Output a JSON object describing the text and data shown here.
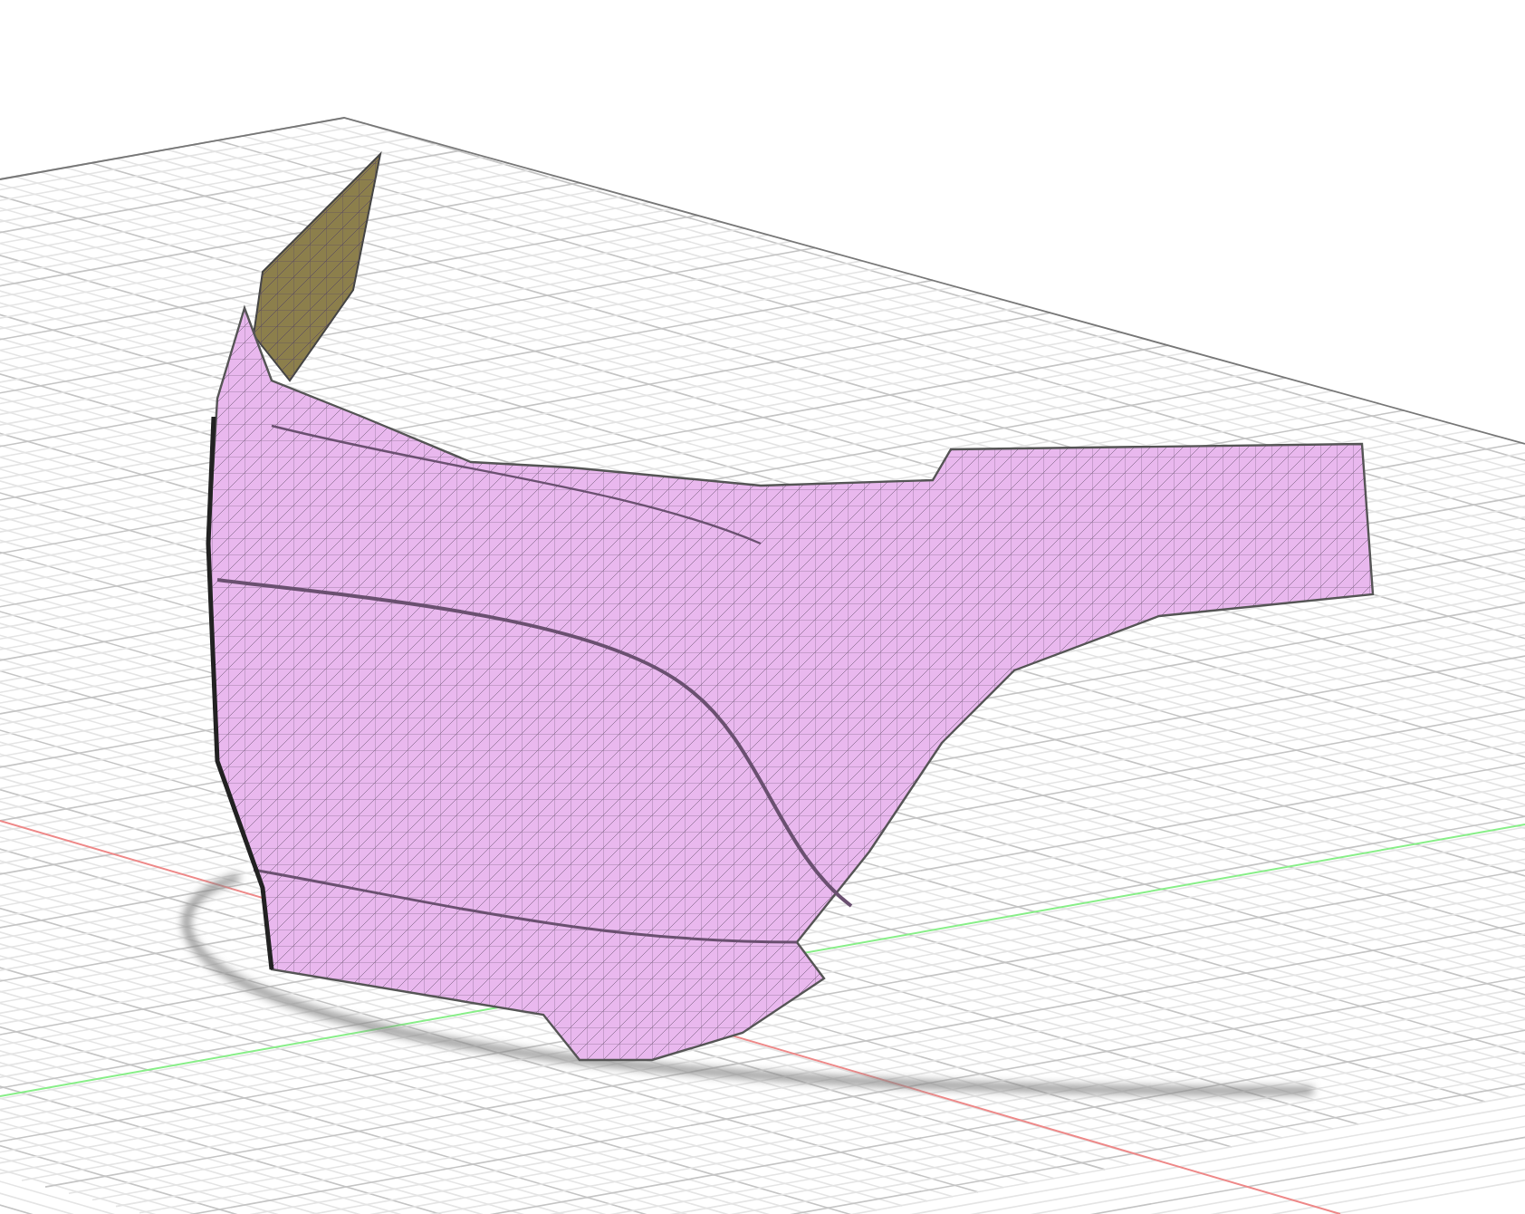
{
  "scene": {
    "kind": "mesh-viewport"
  }
}
